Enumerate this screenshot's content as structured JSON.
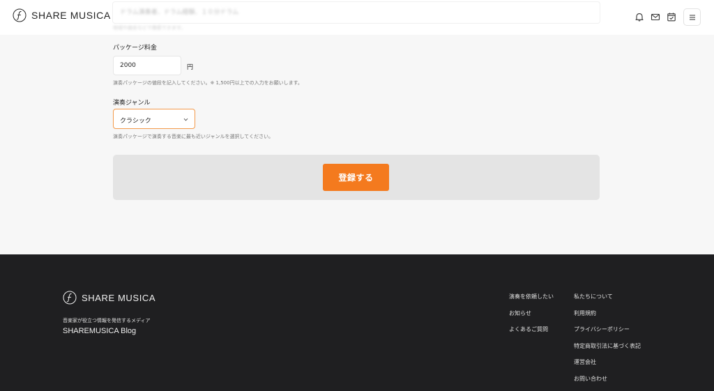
{
  "header": {
    "brand": "SHARE MUSICA",
    "search_text": "ドラム演奏者、ドラム経験、１０分ドラム",
    "search_hint": "地域や曲名などで検索できます。"
  },
  "form": {
    "price_label": "パッケージ料金",
    "price_value": "2000",
    "price_unit": "円",
    "price_help": "演奏パッケージの値段を記入してください。※ 1,500円以上での入力をお願いします。",
    "genre_label": "演奏ジャンル",
    "genre_value": "クラシック",
    "genre_help": "演奏パッケージで演奏する音楽に最も近いジャンルを選択してください。",
    "submit_label": "登録する"
  },
  "footer": {
    "brand": "SHARE MUSICA",
    "tagline": "音楽家が役立つ情報を発信するメディア",
    "blog": "SHAREMUSICA Blog",
    "col1": [
      "演奏を依頼したい",
      "お知らせ",
      "よくあるご質問"
    ],
    "col2": [
      "私たちについて",
      "利用規約",
      "プライバシーポリシー",
      "特定商取引法に基づく表記",
      "運営会社",
      "お問い合わせ"
    ]
  },
  "icons": {
    "bell": "bell-icon",
    "mail": "mail-icon",
    "calendar": "calendar-check-icon",
    "menu": "hamburger-menu-icon",
    "chevron": "chevron-down-icon",
    "logo": "treble-f-logo-icon"
  },
  "colors": {
    "accent": "#f47a1e",
    "select_border": "#f39a4a",
    "footer_bg": "#1f1f21",
    "panel_bg": "#e4e4e4"
  }
}
